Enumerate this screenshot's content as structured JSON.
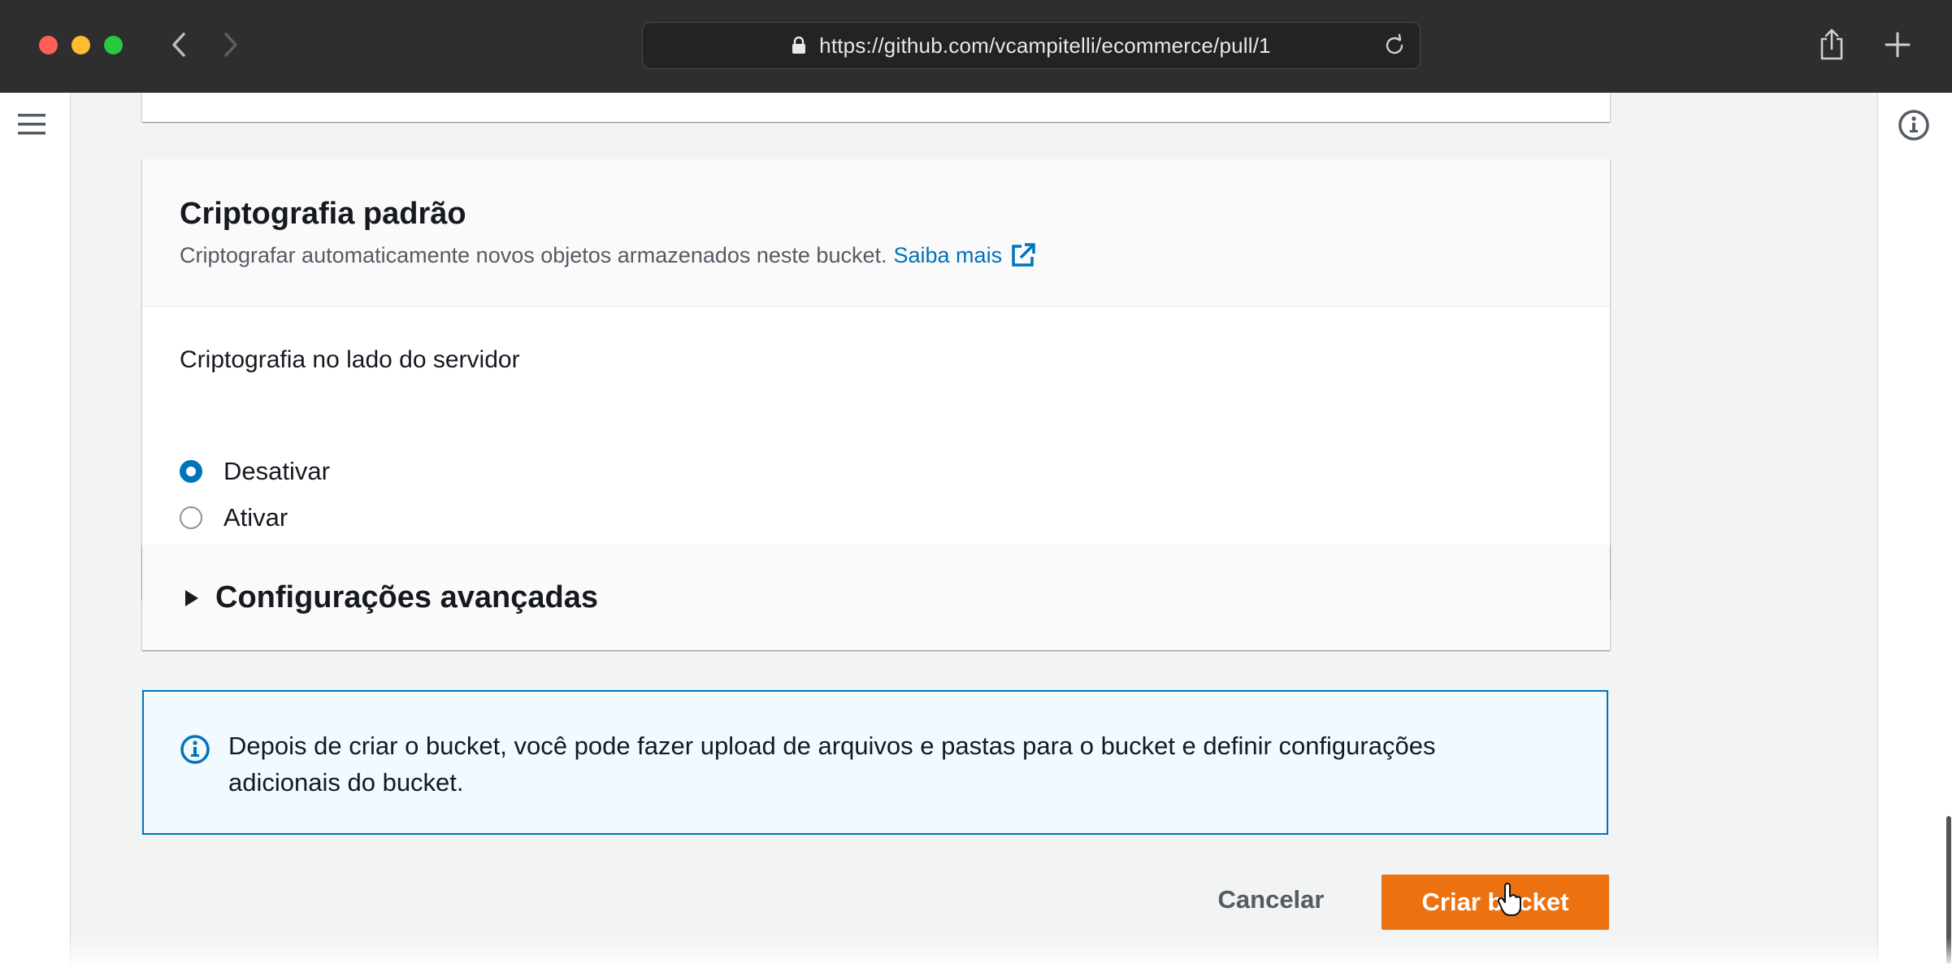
{
  "browser": {
    "url": "https://github.com/vcampitelli/ecommerce/pull/1"
  },
  "encryption": {
    "title": "Criptografia padrão",
    "description": "Criptografar automaticamente novos objetos armazenados neste bucket.",
    "learn_more": "Saiba mais",
    "field_label": "Criptografia no lado do servidor",
    "options": [
      {
        "label": "Desativar",
        "selected": true
      },
      {
        "label": "Ativar",
        "selected": false
      }
    ]
  },
  "advanced": {
    "title": "Configurações avançadas"
  },
  "alert": {
    "text": "Depois de criar o bucket, você pode fazer upload de arquivos e pastas para o bucket e definir configurações adicionais do bucket."
  },
  "actions": {
    "cancel": "Cancelar",
    "create": "Criar bucket"
  },
  "colors": {
    "primary": "#ec7211",
    "link": "#0073bb",
    "info_bg": "#f1faff"
  }
}
